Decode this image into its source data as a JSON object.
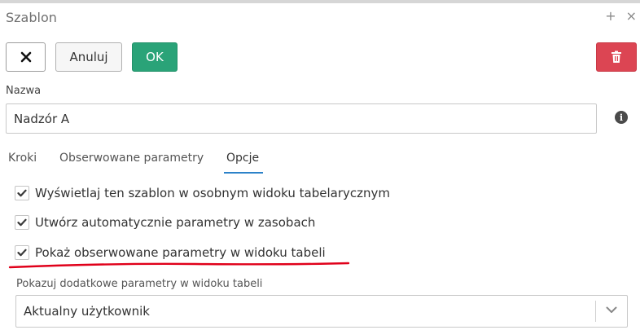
{
  "dialog": {
    "title": "Szablon",
    "actions": {
      "expand_icon": "+",
      "close_icon": "×"
    }
  },
  "toolbar": {
    "close_icon": "close-icon",
    "cancel_label": "Anuluj",
    "ok_label": "OK",
    "delete_icon": "trash-icon",
    "colors": {
      "ok": "#2aa378",
      "delete": "#dc4553"
    }
  },
  "name_field": {
    "label": "Nazwa",
    "value": "Nadzór A",
    "info_icon": "i"
  },
  "tabs": [
    {
      "label": "Kroki",
      "active": false
    },
    {
      "label": "Obserwowane parametry",
      "active": false
    },
    {
      "label": "Opcje",
      "active": true
    }
  ],
  "options": {
    "items": [
      {
        "label": "Wyświetlaj ten szablon w osobnym widoku tabelarycznym",
        "checked": true
      },
      {
        "label": "Utwórz automatycznie parametry w zasobach",
        "checked": true
      },
      {
        "label": "Pokaż obserwowane parametry w widoku tabeli",
        "checked": true,
        "highlighted": true
      }
    ],
    "extra_params": {
      "label": "Pokazuj dodatkowe parametry w widoku tabeli",
      "selected": "Aktualny użytkownik"
    }
  },
  "colors": {
    "active_tab_underline": "#2c82c9",
    "annotation": "#e0001a"
  }
}
